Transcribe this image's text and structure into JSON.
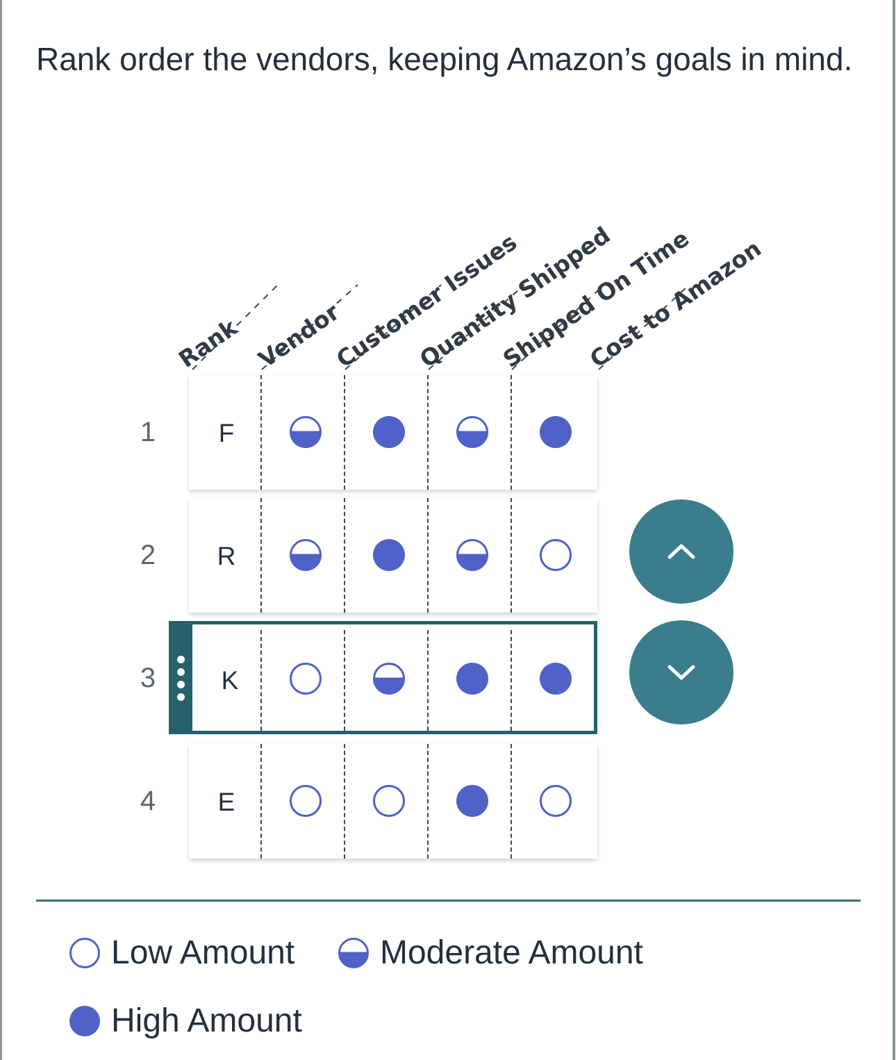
{
  "prompt": "Rank order the vendors, keeping Amazon’s goals in mind.",
  "columns": [
    "Rank",
    "Vendor",
    "Customer Issues",
    "Quantity Shipped",
    "Shipped On Time",
    "Cost to Amazon"
  ],
  "rows": [
    {
      "rank": "1",
      "vendor": "F",
      "levels": [
        "moderate",
        "high",
        "moderate",
        "high"
      ],
      "selected": false
    },
    {
      "rank": "2",
      "vendor": "R",
      "levels": [
        "moderate",
        "high",
        "moderate",
        "low"
      ],
      "selected": false
    },
    {
      "rank": "3",
      "vendor": "K",
      "levels": [
        "low",
        "moderate",
        "high",
        "high"
      ],
      "selected": true
    },
    {
      "rank": "4",
      "vendor": "E",
      "levels": [
        "low",
        "low",
        "high",
        "low"
      ],
      "selected": false
    }
  ],
  "controls": {
    "move_up_icon": "chevron-up-icon",
    "move_down_icon": "chevron-down-icon"
  },
  "legend": {
    "low": "Low Amount",
    "moderate": "Moderate Amount",
    "high": "High Amount"
  },
  "colors": {
    "dot": "#5061c8",
    "accent": "#25606b",
    "button": "#3b7d8c",
    "divider": "#3d6f7b"
  }
}
